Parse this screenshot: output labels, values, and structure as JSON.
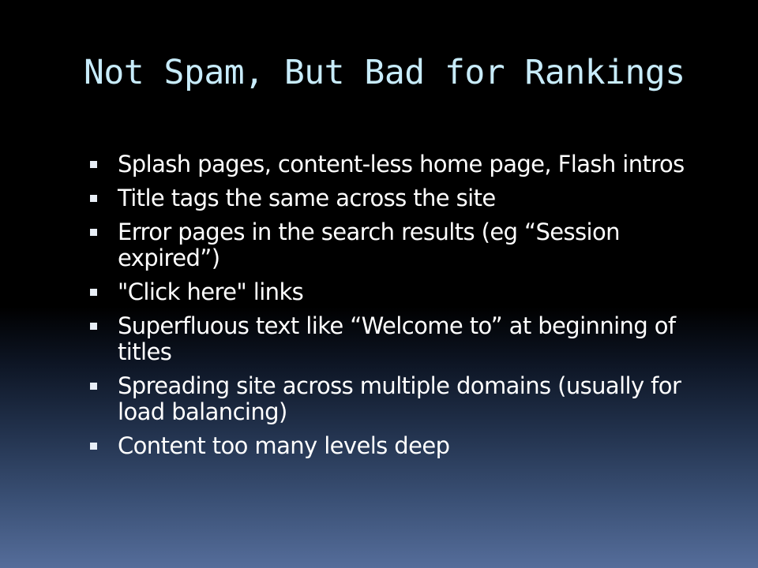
{
  "slide": {
    "title": "Not Spam, But Bad for Rankings",
    "bullets": [
      {
        "text": "Splash pages, content-less home page, Flash intros"
      },
      {
        "text": "Title tags the same across the site"
      },
      {
        "text": "Error pages in the search results (eg “Session expired”)"
      },
      {
        "text": "\"Click here\" links"
      },
      {
        "text": "Superfluous text like “Welcome to” at beginning of titles"
      },
      {
        "text": "Spreading site across multiple domains (usually for load balancing)"
      },
      {
        "text": "Content too many levels deep"
      }
    ]
  },
  "colors": {
    "title": "#c8ecfb",
    "body_text": "#ffffff",
    "background_top": "#000000",
    "background_bottom": "#556d9a",
    "bullet_marker": "#e8eef6"
  }
}
